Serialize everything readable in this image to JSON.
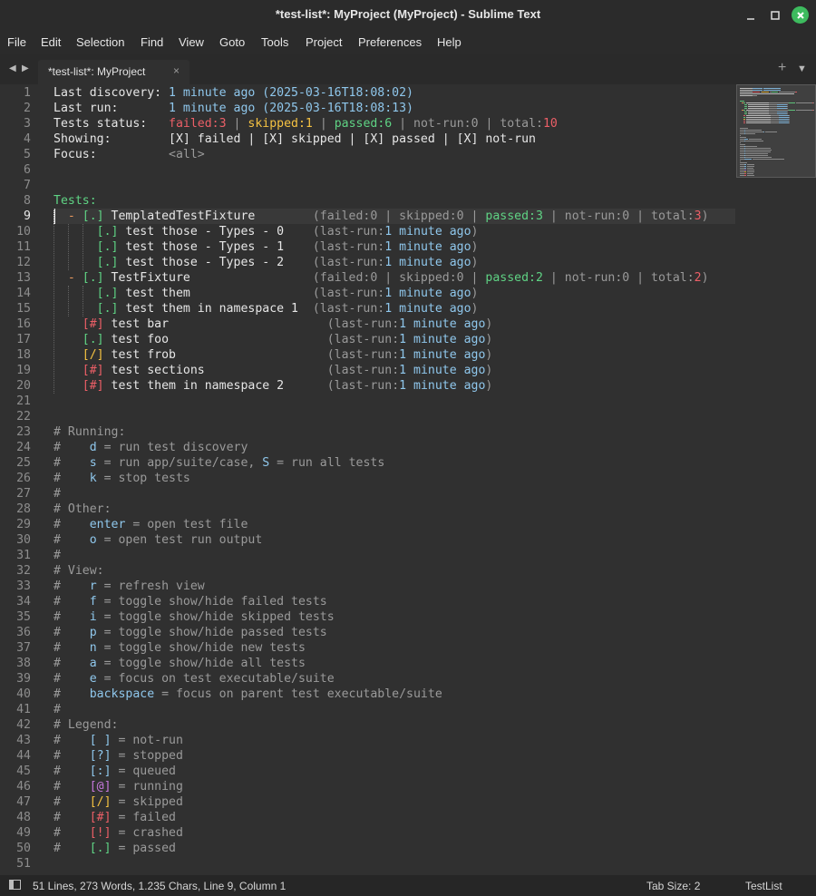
{
  "window": {
    "title": "*test-list*: MyProject (MyProject) - Sublime Text"
  },
  "menu": [
    "File",
    "Edit",
    "Selection",
    "Find",
    "View",
    "Goto",
    "Tools",
    "Project",
    "Preferences",
    "Help"
  ],
  "tab": {
    "label": "*test-list*: MyProject",
    "close": "×"
  },
  "status": {
    "info": "51 Lines, 273 Words, 1.235 Chars, Line 9, Column 1",
    "tab_size": "Tab Size: 2",
    "syntax": "TestList"
  },
  "colors": {
    "window_bg": "#2b2b2b",
    "editor_bg": "#303030",
    "status_bg": "#262626",
    "close_button": "#3dbb5e",
    "green": "#5fd384",
    "red": "#ec5f67",
    "yellow": "#f5c242",
    "blue": "#8fc7ec",
    "purple": "#c678dd"
  },
  "icons": {
    "back": "back-arrow-icon",
    "forward": "forward-arrow-icon",
    "new_tab": "plus-icon",
    "tab_list": "chevron-down-icon",
    "panel": "panel-toggle-icon",
    "minimize": "minimize-icon",
    "maximize": "maximize-icon",
    "close": "close-icon"
  },
  "editor": {
    "current_line": 9,
    "lines": [
      [
        [
          "Last discovery: ",
          "w"
        ],
        [
          "1 minute ago",
          "b"
        ],
        [
          " (2025-03-16T18:08:02)",
          "b"
        ]
      ],
      [
        [
          "Last run:       ",
          "w"
        ],
        [
          "1 minute ago",
          "b"
        ],
        [
          " (2025-03-16T18:08:13)",
          "b"
        ]
      ],
      [
        [
          "Tests status:   ",
          "w"
        ],
        [
          "failed:3",
          "r"
        ],
        [
          " | ",
          "d"
        ],
        [
          "skipped:1",
          "y"
        ],
        [
          " | ",
          "d"
        ],
        [
          "passed:6",
          "g"
        ],
        [
          " | not-run:0 | total:",
          "d"
        ],
        [
          "10",
          "r"
        ]
      ],
      [
        [
          "Showing:        [X] failed | [X] skipped | [X] passed | [X] not-run",
          "w"
        ]
      ],
      [
        [
          "Focus:          ",
          "w"
        ],
        [
          "<all>",
          "d"
        ]
      ],
      [],
      [],
      [
        [
          "Tests:",
          "g"
        ]
      ],
      [
        [
          "  - ",
          "o"
        ],
        [
          "[.]",
          "g"
        ],
        [
          " TemplatedTestFixture        ",
          "w"
        ],
        [
          "(failed:0 | skipped:0 | ",
          "d"
        ],
        [
          "passed:3",
          "g"
        ],
        [
          " | not-run:0 | total:",
          "d"
        ],
        [
          "3",
          "r"
        ],
        [
          ")",
          "d"
        ]
      ],
      [
        [
          "      ",
          "w"
        ],
        [
          "[.]",
          "g"
        ],
        [
          " test those - Types - 0    ",
          "w"
        ],
        [
          "(last-run:",
          "d"
        ],
        [
          "1 minute ago",
          "b"
        ],
        [
          ")",
          "d"
        ]
      ],
      [
        [
          "      ",
          "w"
        ],
        [
          "[.]",
          "g"
        ],
        [
          " test those - Types - 1    ",
          "w"
        ],
        [
          "(last-run:",
          "d"
        ],
        [
          "1 minute ago",
          "b"
        ],
        [
          ")",
          "d"
        ]
      ],
      [
        [
          "      ",
          "w"
        ],
        [
          "[.]",
          "g"
        ],
        [
          " test those - Types - 2    ",
          "w"
        ],
        [
          "(last-run:",
          "d"
        ],
        [
          "1 minute ago",
          "b"
        ],
        [
          ")",
          "d"
        ]
      ],
      [
        [
          "  - ",
          "o"
        ],
        [
          "[.]",
          "g"
        ],
        [
          " TestFixture                 ",
          "w"
        ],
        [
          "(failed:0 | skipped:0 | ",
          "d"
        ],
        [
          "passed:2",
          "g"
        ],
        [
          " | not-run:0 | total:",
          "d"
        ],
        [
          "2",
          "r"
        ],
        [
          ")",
          "d"
        ]
      ],
      [
        [
          "      ",
          "w"
        ],
        [
          "[.]",
          "g"
        ],
        [
          " test them                 ",
          "w"
        ],
        [
          "(last-run:",
          "d"
        ],
        [
          "1 minute ago",
          "b"
        ],
        [
          ")",
          "d"
        ]
      ],
      [
        [
          "      ",
          "w"
        ],
        [
          "[.]",
          "g"
        ],
        [
          " test them in namespace 1  ",
          "w"
        ],
        [
          "(last-run:",
          "d"
        ],
        [
          "1 minute ago",
          "b"
        ],
        [
          ")",
          "d"
        ]
      ],
      [
        [
          "    ",
          "w"
        ],
        [
          "[#]",
          "r"
        ],
        [
          " test bar                      ",
          "w"
        ],
        [
          "(last-run:",
          "d"
        ],
        [
          "1 minute ago",
          "b"
        ],
        [
          ")",
          "d"
        ]
      ],
      [
        [
          "    ",
          "w"
        ],
        [
          "[.]",
          "g"
        ],
        [
          " test foo                      ",
          "w"
        ],
        [
          "(last-run:",
          "d"
        ],
        [
          "1 minute ago",
          "b"
        ],
        [
          ")",
          "d"
        ]
      ],
      [
        [
          "    ",
          "w"
        ],
        [
          "[/]",
          "y"
        ],
        [
          " test frob                     ",
          "w"
        ],
        [
          "(last-run:",
          "d"
        ],
        [
          "1 minute ago",
          "b"
        ],
        [
          ")",
          "d"
        ]
      ],
      [
        [
          "    ",
          "w"
        ],
        [
          "[#]",
          "r"
        ],
        [
          " test sections                 ",
          "w"
        ],
        [
          "(last-run:",
          "d"
        ],
        [
          "1 minute ago",
          "b"
        ],
        [
          ")",
          "d"
        ]
      ],
      [
        [
          "    ",
          "w"
        ],
        [
          "[#]",
          "r"
        ],
        [
          " test them in namespace 2      ",
          "w"
        ],
        [
          "(last-run:",
          "d"
        ],
        [
          "1 minute ago",
          "b"
        ],
        [
          ")",
          "d"
        ]
      ],
      [],
      [],
      [
        [
          "# Running:",
          "d"
        ]
      ],
      [
        [
          "#    ",
          "d"
        ],
        [
          "d",
          "b"
        ],
        [
          " = run test discovery",
          "d"
        ]
      ],
      [
        [
          "#    ",
          "d"
        ],
        [
          "s",
          "b"
        ],
        [
          " = run app/suite/case, ",
          "d"
        ],
        [
          "S",
          "b"
        ],
        [
          " = run all tests",
          "d"
        ]
      ],
      [
        [
          "#    ",
          "d"
        ],
        [
          "k",
          "b"
        ],
        [
          " = stop tests",
          "d"
        ]
      ],
      [
        [
          "#",
          "d"
        ]
      ],
      [
        [
          "# Other:",
          "d"
        ]
      ],
      [
        [
          "#    ",
          "d"
        ],
        [
          "enter",
          "b"
        ],
        [
          " = open test file",
          "d"
        ]
      ],
      [
        [
          "#    ",
          "d"
        ],
        [
          "o",
          "b"
        ],
        [
          " = open test run output",
          "d"
        ]
      ],
      [
        [
          "#",
          "d"
        ]
      ],
      [
        [
          "# View:",
          "d"
        ]
      ],
      [
        [
          "#    ",
          "d"
        ],
        [
          "r",
          "b"
        ],
        [
          " = refresh view",
          "d"
        ]
      ],
      [
        [
          "#    ",
          "d"
        ],
        [
          "f",
          "b"
        ],
        [
          " = toggle show/hide failed tests",
          "d"
        ]
      ],
      [
        [
          "#    ",
          "d"
        ],
        [
          "i",
          "b"
        ],
        [
          " = toggle show/hide skipped tests",
          "d"
        ]
      ],
      [
        [
          "#    ",
          "d"
        ],
        [
          "p",
          "b"
        ],
        [
          " = toggle show/hide passed tests",
          "d"
        ]
      ],
      [
        [
          "#    ",
          "d"
        ],
        [
          "n",
          "b"
        ],
        [
          " = toggle show/hide new tests",
          "d"
        ]
      ],
      [
        [
          "#    ",
          "d"
        ],
        [
          "a",
          "b"
        ],
        [
          " = toggle show/hide all tests",
          "d"
        ]
      ],
      [
        [
          "#    ",
          "d"
        ],
        [
          "e",
          "b"
        ],
        [
          " = focus on test executable/suite",
          "d"
        ]
      ],
      [
        [
          "#    ",
          "d"
        ],
        [
          "backspace",
          "b"
        ],
        [
          " = focus on parent test executable/suite",
          "d"
        ]
      ],
      [
        [
          "#",
          "d"
        ]
      ],
      [
        [
          "# Legend:",
          "d"
        ]
      ],
      [
        [
          "#    ",
          "d"
        ],
        [
          "[ ]",
          "b"
        ],
        [
          " = not-run",
          "d"
        ]
      ],
      [
        [
          "#    ",
          "d"
        ],
        [
          "[?]",
          "b"
        ],
        [
          " = stopped",
          "d"
        ]
      ],
      [
        [
          "#    ",
          "d"
        ],
        [
          "[:]",
          "b"
        ],
        [
          " = queued",
          "d"
        ]
      ],
      [
        [
          "#    ",
          "d"
        ],
        [
          "[@]",
          "pu"
        ],
        [
          " = running",
          "d"
        ]
      ],
      [
        [
          "#    ",
          "d"
        ],
        [
          "[/]",
          "y"
        ],
        [
          " = skipped",
          "d"
        ]
      ],
      [
        [
          "#    ",
          "d"
        ],
        [
          "[#]",
          "r"
        ],
        [
          " = failed",
          "d"
        ]
      ],
      [
        [
          "#    ",
          "d"
        ],
        [
          "[!]",
          "r"
        ],
        [
          " = crashed",
          "d"
        ]
      ],
      [
        [
          "#    ",
          "d"
        ],
        [
          "[.]",
          "g"
        ],
        [
          " = passed",
          "d"
        ]
      ],
      []
    ]
  }
}
